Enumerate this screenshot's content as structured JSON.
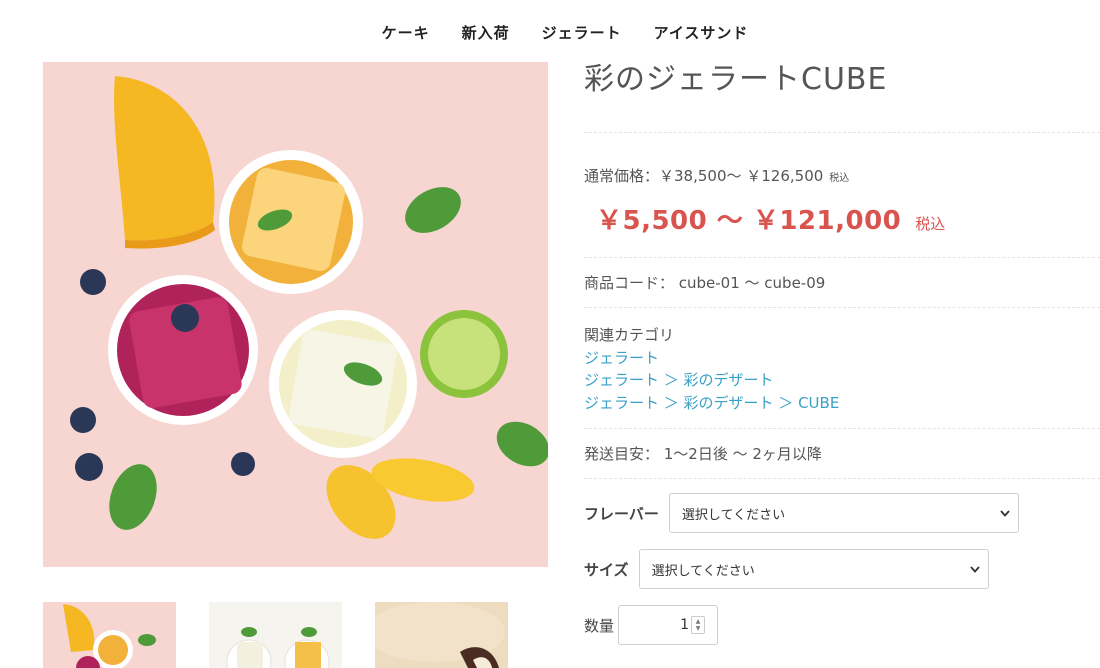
{
  "nav": {
    "items": [
      "ケーキ",
      "新入荷",
      "ジェラート",
      "アイスサンド"
    ]
  },
  "product": {
    "title": "彩のジェラートCUBE",
    "regular_price_label": "通常価格：￥38,500〜 ￥126,500",
    "regular_tax": "税込",
    "sale_price": "￥5,500 〜 ￥121,000",
    "sale_tax": "税込",
    "code": "商品コード： cube-01 〜 cube-09",
    "category_label": "関連カテゴリ",
    "categories": [
      "ジェラート",
      "ジェラート ＞ 彩のデザート",
      "ジェラート ＞ 彩のデザート ＞ CUBE"
    ],
    "shipping": "発送目安： 1〜2日後 〜 2ヶ月以降",
    "flavor_label": "フレーバー",
    "flavor_value": "選択してください",
    "size_label": "サイズ",
    "size_value": "選択してください",
    "qty_label": "数量",
    "qty_value": "1"
  },
  "colors": {
    "sale": "#d9534f",
    "link": "#3aa0c7",
    "image_bg": "#f7d7d2"
  },
  "icons": {
    "select_arrow": "chevron-down-icon",
    "qty_spinner": "spinner-icon"
  }
}
